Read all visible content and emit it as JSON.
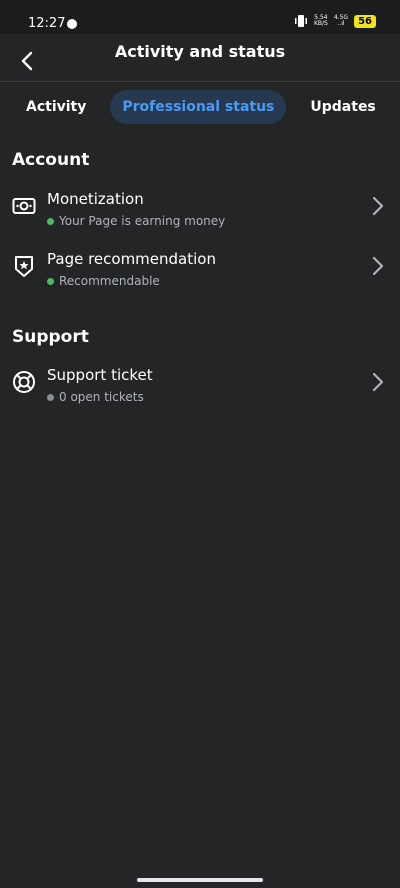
{
  "status_bar": {
    "time": "12:27",
    "net_speed_top": "5.54",
    "net_speed_bottom": "KB/S",
    "signal_top": "4.5G",
    "signal_bottom": "..ıl",
    "battery": "56"
  },
  "header": {
    "title": "Activity and status"
  },
  "tabs": [
    {
      "label": "Activity",
      "active": false
    },
    {
      "label": "Professional status",
      "active": true
    },
    {
      "label": "Updates",
      "active": false
    }
  ],
  "sections": {
    "account": {
      "title": "Account",
      "items": [
        {
          "title": "Monetization",
          "subtitle": "Your Page is earning money",
          "status_color": "#45bd62",
          "icon": "money-icon"
        },
        {
          "title": "Page recommendation",
          "subtitle": "Recommendable",
          "status_color": "#45bd62",
          "icon": "star-shield-icon"
        }
      ]
    },
    "support": {
      "title": "Support",
      "items": [
        {
          "title": "Support ticket",
          "subtitle": "0 open tickets",
          "status_color": "#8a8d91",
          "icon": "lifebuoy-icon"
        }
      ]
    }
  },
  "colors": {
    "background": "#242526",
    "accent": "#4a9bf3",
    "active_tab_bg": "#263951"
  }
}
